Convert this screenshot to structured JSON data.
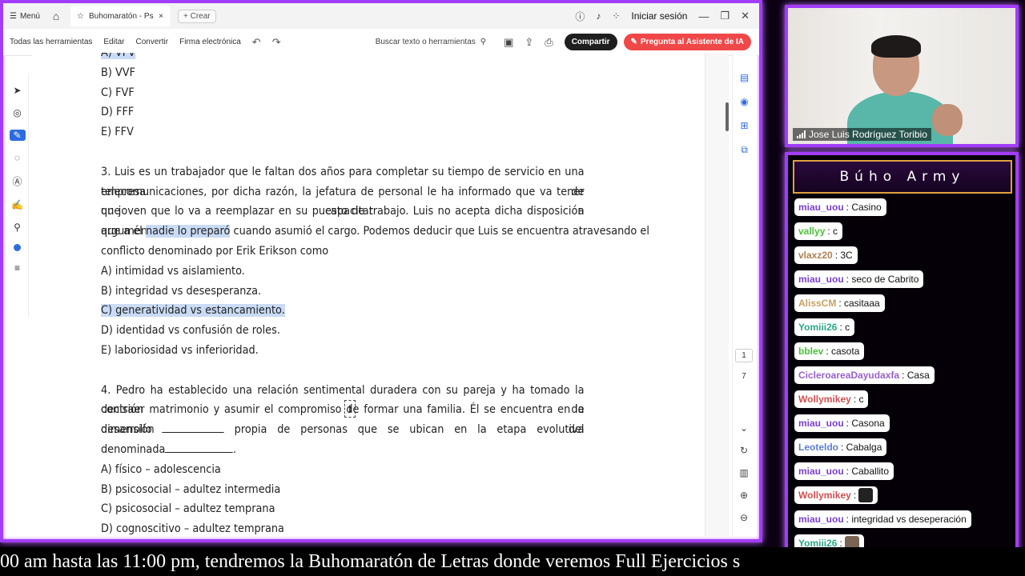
{
  "browser": {
    "menu_label": "Menú",
    "tab_title": "Buhomaratón - Psicol...",
    "create_label": "Crear",
    "signin_label": "Iniciar sesión"
  },
  "toolbar": {
    "tools": [
      "Todas las herramientas",
      "Editar",
      "Convertir",
      "Firma electrónica"
    ],
    "search_label": "Buscar texto o herramientas",
    "share_label": "Compartir",
    "ai_label": "Pregunta al Asistente de IA"
  },
  "document": {
    "q2_options": [
      "B) VVF",
      "C) FVF",
      "D) FFF",
      "E) FFV"
    ],
    "q3_lines": [
      "3. Luis es un trabajador que le faltan dos años para completar su tiempo de servicio en una empresa de",
      "telecomunicaciones, por dicha razón, la jefatura de personal le ha informado que va tener que capacitar a",
      "un joven que lo va a reemplazar en su puesto de trabajo. Luis no acepta dicha disposición argumentando"
    ],
    "q3_line4_pre": "que a él ",
    "q3_line4_hl": "nadie lo preparó",
    "q3_line4_post": " cuando asumió el cargo. Podemos deducir que Luis se encuentra atravesando el",
    "q3_line5": "conflicto denominado por Erik Erikson como",
    "q3_options": [
      "A) intimidad vs aislamiento.",
      "B) integridad vs desesperanza.",
      "C) generatividad vs estancamiento.",
      "D) identidad vs confusión de roles.",
      "E) laboriosidad vs inferioridad."
    ],
    "q4_line1": "4. Pedro ha establecido una relación sentimental duradera con su pareja y ha tomado la decisión de",
    "q4_line2": "contraer matrimonio y asumir el compromiso de formar una familia. Él se encuentra en la dimensión del",
    "q4_line3_a": "desarrollo",
    "q4_line3_b": "propia de personas que se ubican en la etapa evolutiva",
    "q4_line4": "denominada",
    "q4_line4_end": ".",
    "q4_options": [
      "A) físico – adolescencia",
      "B) psicosocial – adultez intermedia",
      "C) psicosocial – adultez temprana",
      "D) cognoscitivo – adultez temprana"
    ],
    "page_current": "1",
    "page_total": "7"
  },
  "webcam": {
    "name": "Jose Luis Rodríguez Toribio"
  },
  "chat": {
    "title": "Búho Army",
    "messages": [
      {
        "user": "miau_uou",
        "text": ": Casino",
        "color": "#7b3fd0"
      },
      {
        "user": "vallyy",
        "text": ": c",
        "color": "#4cc23a"
      },
      {
        "user": "vlaxz20",
        "text": ": 3C",
        "color": "#b08050"
      },
      {
        "user": "miau_uou",
        "text": ": seco de Cabrito",
        "color": "#7b3fd0"
      },
      {
        "user": "AlissCM",
        "text": ": casitaaa",
        "color": "#c8a060"
      },
      {
        "user": "Yomiii26",
        "text": ": c",
        "color": "#2aa886"
      },
      {
        "user": "bblev",
        "text": ": casota",
        "color": "#4cc23a"
      },
      {
        "user": "CicleroareaDayudaxfa",
        "text": ": Casa",
        "color": "#9a60d0"
      },
      {
        "user": "Wollymikey",
        "text": ": c",
        "color": "#d05050"
      },
      {
        "user": "miau_uou",
        "text": ": Casona",
        "color": "#7b3fd0"
      },
      {
        "user": "Leoteldo",
        "text": ": Cabalga",
        "color": "#5a7fd0"
      },
      {
        "user": "miau_uou",
        "text": ": Caballito",
        "color": "#7b3fd0"
      },
      {
        "user": "Wollymikey",
        "text": ":",
        "color": "#d05050",
        "emote": "dark"
      },
      {
        "user": "miau_uou",
        "text": ": integridad vs deseperación",
        "color": "#7b3fd0"
      },
      {
        "user": "Yomiii26",
        "text": ":",
        "color": "#2aa886",
        "emote": "brown"
      }
    ]
  },
  "ticker": {
    "text": "00 am hasta las 11:00 pm, tendremos la Buhomaratón de Letras donde veremos Full Ejercicios s"
  }
}
